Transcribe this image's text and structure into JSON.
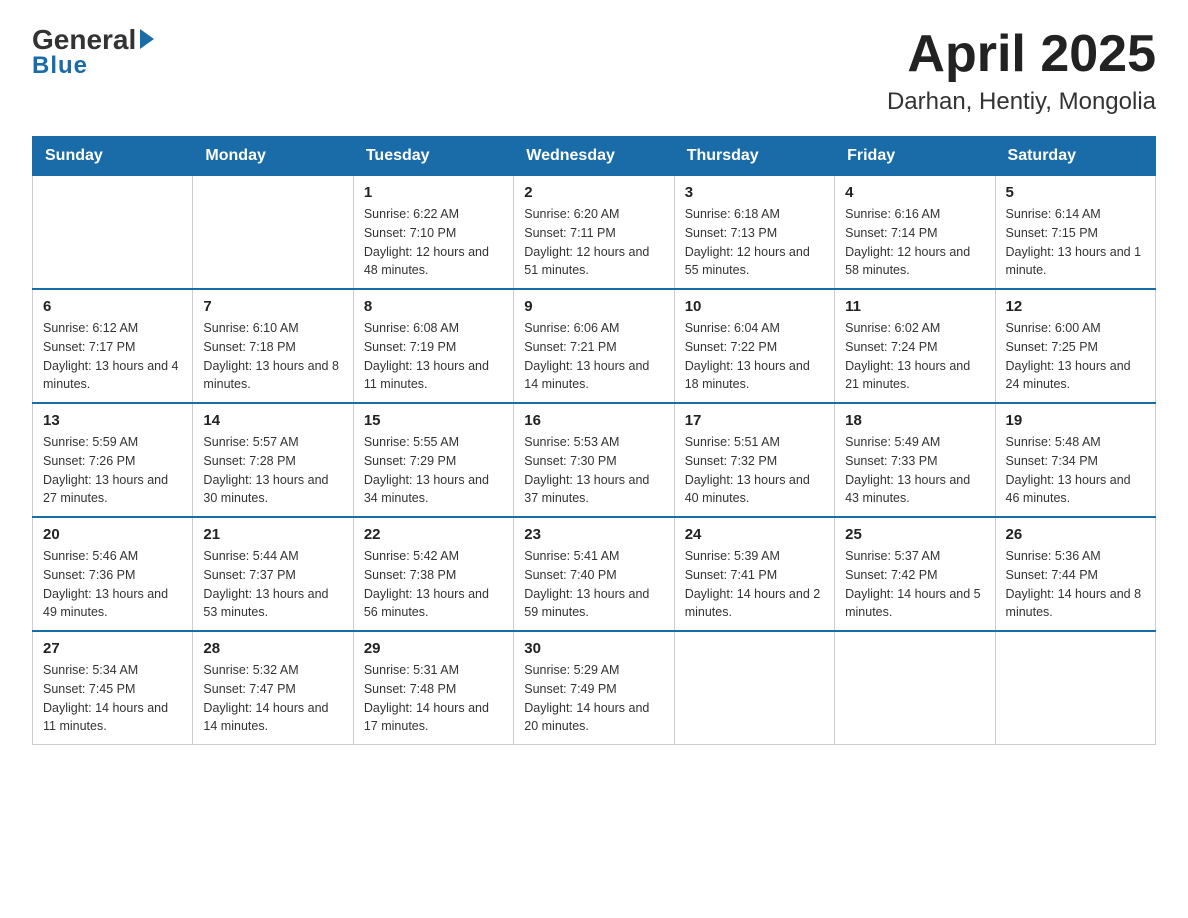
{
  "logo": {
    "general": "General",
    "blue": "Blue"
  },
  "header": {
    "month": "April 2025",
    "location": "Darhan, Hentiy, Mongolia"
  },
  "days_of_week": [
    "Sunday",
    "Monday",
    "Tuesday",
    "Wednesday",
    "Thursday",
    "Friday",
    "Saturday"
  ],
  "weeks": [
    [
      {
        "day": "",
        "info": ""
      },
      {
        "day": "",
        "info": ""
      },
      {
        "day": "1",
        "info": "Sunrise: 6:22 AM\nSunset: 7:10 PM\nDaylight: 12 hours\nand 48 minutes."
      },
      {
        "day": "2",
        "info": "Sunrise: 6:20 AM\nSunset: 7:11 PM\nDaylight: 12 hours\nand 51 minutes."
      },
      {
        "day": "3",
        "info": "Sunrise: 6:18 AM\nSunset: 7:13 PM\nDaylight: 12 hours\nand 55 minutes."
      },
      {
        "day": "4",
        "info": "Sunrise: 6:16 AM\nSunset: 7:14 PM\nDaylight: 12 hours\nand 58 minutes."
      },
      {
        "day": "5",
        "info": "Sunrise: 6:14 AM\nSunset: 7:15 PM\nDaylight: 13 hours\nand 1 minute."
      }
    ],
    [
      {
        "day": "6",
        "info": "Sunrise: 6:12 AM\nSunset: 7:17 PM\nDaylight: 13 hours\nand 4 minutes."
      },
      {
        "day": "7",
        "info": "Sunrise: 6:10 AM\nSunset: 7:18 PM\nDaylight: 13 hours\nand 8 minutes."
      },
      {
        "day": "8",
        "info": "Sunrise: 6:08 AM\nSunset: 7:19 PM\nDaylight: 13 hours\nand 11 minutes."
      },
      {
        "day": "9",
        "info": "Sunrise: 6:06 AM\nSunset: 7:21 PM\nDaylight: 13 hours\nand 14 minutes."
      },
      {
        "day": "10",
        "info": "Sunrise: 6:04 AM\nSunset: 7:22 PM\nDaylight: 13 hours\nand 18 minutes."
      },
      {
        "day": "11",
        "info": "Sunrise: 6:02 AM\nSunset: 7:24 PM\nDaylight: 13 hours\nand 21 minutes."
      },
      {
        "day": "12",
        "info": "Sunrise: 6:00 AM\nSunset: 7:25 PM\nDaylight: 13 hours\nand 24 minutes."
      }
    ],
    [
      {
        "day": "13",
        "info": "Sunrise: 5:59 AM\nSunset: 7:26 PM\nDaylight: 13 hours\nand 27 minutes."
      },
      {
        "day": "14",
        "info": "Sunrise: 5:57 AM\nSunset: 7:28 PM\nDaylight: 13 hours\nand 30 minutes."
      },
      {
        "day": "15",
        "info": "Sunrise: 5:55 AM\nSunset: 7:29 PM\nDaylight: 13 hours\nand 34 minutes."
      },
      {
        "day": "16",
        "info": "Sunrise: 5:53 AM\nSunset: 7:30 PM\nDaylight: 13 hours\nand 37 minutes."
      },
      {
        "day": "17",
        "info": "Sunrise: 5:51 AM\nSunset: 7:32 PM\nDaylight: 13 hours\nand 40 minutes."
      },
      {
        "day": "18",
        "info": "Sunrise: 5:49 AM\nSunset: 7:33 PM\nDaylight: 13 hours\nand 43 minutes."
      },
      {
        "day": "19",
        "info": "Sunrise: 5:48 AM\nSunset: 7:34 PM\nDaylight: 13 hours\nand 46 minutes."
      }
    ],
    [
      {
        "day": "20",
        "info": "Sunrise: 5:46 AM\nSunset: 7:36 PM\nDaylight: 13 hours\nand 49 minutes."
      },
      {
        "day": "21",
        "info": "Sunrise: 5:44 AM\nSunset: 7:37 PM\nDaylight: 13 hours\nand 53 minutes."
      },
      {
        "day": "22",
        "info": "Sunrise: 5:42 AM\nSunset: 7:38 PM\nDaylight: 13 hours\nand 56 minutes."
      },
      {
        "day": "23",
        "info": "Sunrise: 5:41 AM\nSunset: 7:40 PM\nDaylight: 13 hours\nand 59 minutes."
      },
      {
        "day": "24",
        "info": "Sunrise: 5:39 AM\nSunset: 7:41 PM\nDaylight: 14 hours\nand 2 minutes."
      },
      {
        "day": "25",
        "info": "Sunrise: 5:37 AM\nSunset: 7:42 PM\nDaylight: 14 hours\nand 5 minutes."
      },
      {
        "day": "26",
        "info": "Sunrise: 5:36 AM\nSunset: 7:44 PM\nDaylight: 14 hours\nand 8 minutes."
      }
    ],
    [
      {
        "day": "27",
        "info": "Sunrise: 5:34 AM\nSunset: 7:45 PM\nDaylight: 14 hours\nand 11 minutes."
      },
      {
        "day": "28",
        "info": "Sunrise: 5:32 AM\nSunset: 7:47 PM\nDaylight: 14 hours\nand 14 minutes."
      },
      {
        "day": "29",
        "info": "Sunrise: 5:31 AM\nSunset: 7:48 PM\nDaylight: 14 hours\nand 17 minutes."
      },
      {
        "day": "30",
        "info": "Sunrise: 5:29 AM\nSunset: 7:49 PM\nDaylight: 14 hours\nand 20 minutes."
      },
      {
        "day": "",
        "info": ""
      },
      {
        "day": "",
        "info": ""
      },
      {
        "day": "",
        "info": ""
      }
    ]
  ]
}
